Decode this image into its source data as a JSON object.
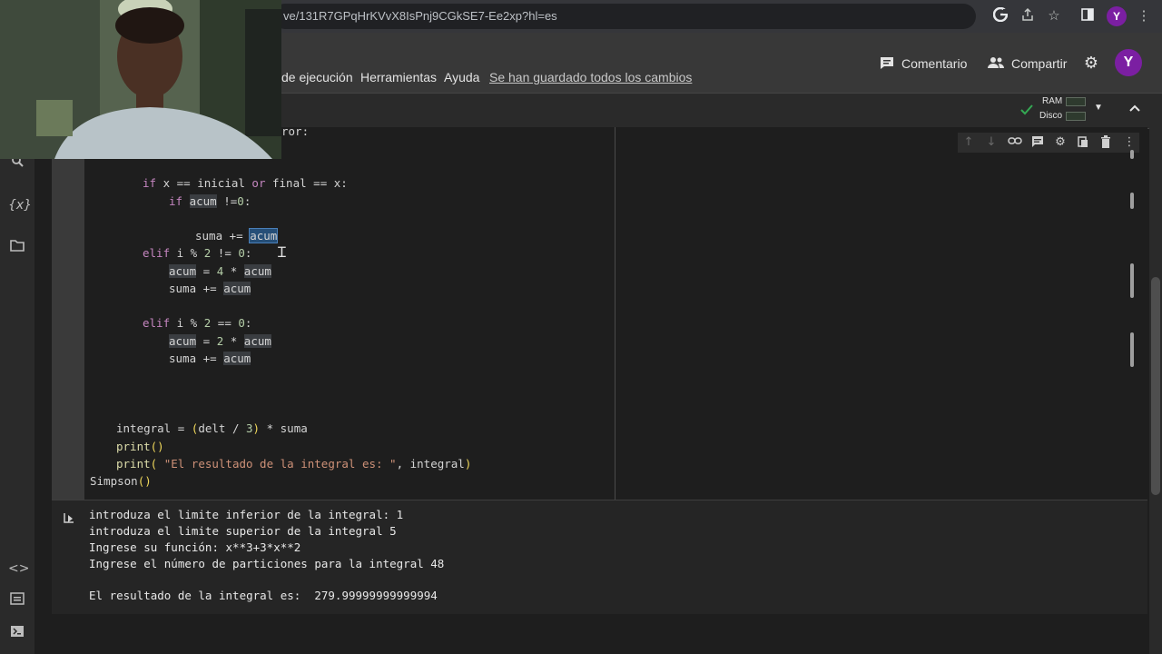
{
  "browser": {
    "url": "ve/131R7GPqHrKVvX8IsPnj9CGkSE7-Ee2xp?hl=es",
    "avatar": "Y"
  },
  "menu": {
    "items": [
      "de ejecución",
      "Herramientas",
      "Ayuda"
    ],
    "saved_status": "Se han guardado todos los cambios"
  },
  "header": {
    "comment_label": "Comentario",
    "share_label": "Compartir",
    "avatar": "Y"
  },
  "resources": {
    "ram_label": "RAM",
    "disk_label": "Disco"
  },
  "code": {
    "partial_line": "ror:",
    "lines": [
      "if x == inicial or final == x:",
      "if acum !=0:",
      "suma += acum",
      "elif i % 2 != 0:",
      "acum = 4 * acum",
      "suma += acum",
      "elif i % 2 == 0:",
      "acum = 2 * acum",
      "suma += acum",
      "integral = (delt / 3) * suma",
      "print()",
      "print( \"El resultado de la integral es: \", integral)",
      "Simpson()"
    ]
  },
  "output": {
    "lines": [
      "introduza el limite inferior de la integral: 1",
      "introduza el limite superior de la integral 5",
      "Ingrese su función: x**3+3*x**2",
      "Ingrese el número de particiones para la integral 48",
      "",
      "El resultado de la integral es:  279.99999999999994"
    ]
  },
  "icons": {
    "left_rail": [
      "search-icon",
      "variables-icon",
      "folder-icon",
      "code-snippets-icon",
      "command-palette-icon",
      "terminal-icon"
    ],
    "cell_toolbar": [
      "move-up-icon",
      "move-down-icon",
      "link-icon",
      "comment-icon",
      "settings-icon",
      "mirror-cell-icon",
      "delete-icon",
      "more-icon"
    ]
  },
  "colors": {
    "accent_avatar": "#7b1fa2",
    "ram_ok": "#34a853"
  }
}
